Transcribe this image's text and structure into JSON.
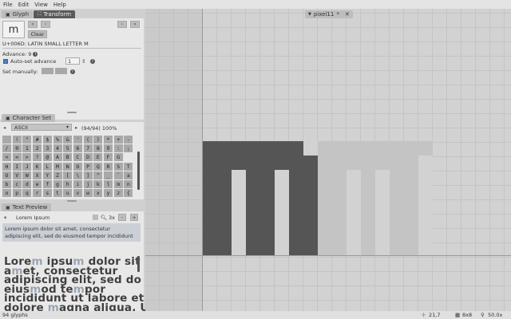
{
  "menu": [
    "File",
    "Edit",
    "View",
    "Help"
  ],
  "left_tabs": [
    {
      "icon": "▣",
      "label": "Glyph",
      "active": false
    },
    {
      "icon": "⛶",
      "label": "Transform",
      "active": true
    }
  ],
  "glyph": {
    "char": "m",
    "clear_label": "Clear",
    "nav_prev_prev": "«",
    "nav_prev": "‹",
    "nav_next": "›",
    "nav_next_next": "»",
    "code_label": "U+006D: LATIN SMALL LETTER M",
    "advance_label": "Advance: 9",
    "auto_advance_label": "Auto-set advance",
    "auto_advance_value": "1",
    "set_manually_label": "Set manually:"
  },
  "charset": {
    "tab_label": "Character Set",
    "tab_icon": "▣",
    "selected_set": "ASCII",
    "count_label": "(94/94) 100%",
    "rows": [
      [
        " ",
        "!",
        "\"",
        "#",
        "$",
        "%",
        "&",
        "'",
        "(",
        ")",
        "*",
        "+",
        "-"
      ],
      [
        "/",
        "0",
        "1",
        "2",
        "3",
        "4",
        "5",
        "6",
        "7",
        "8",
        "9",
        ":",
        ";"
      ],
      [
        "<",
        "=",
        ">",
        "?",
        "@",
        "A",
        "B",
        "C",
        "D",
        "E",
        "F",
        "G"
      ],
      [
        "H",
        "I",
        "J",
        "K",
        "L",
        "M",
        "N",
        "O",
        "P",
        "Q",
        "R",
        "S",
        "T"
      ],
      [
        "U",
        "V",
        "W",
        "X",
        "Y",
        "Z",
        "[",
        "\\",
        "]",
        "^",
        "_",
        "`",
        "a"
      ],
      [
        "b",
        "c",
        "d",
        "e",
        "f",
        "g",
        "h",
        "i",
        "j",
        "k",
        "l",
        "m",
        "n"
      ],
      [
        "o",
        "p",
        "q",
        "r",
        "s",
        "t",
        "u",
        "v",
        "w",
        "x",
        "y",
        "z",
        "{"
      ]
    ]
  },
  "preview": {
    "tab_label": "Text Preview",
    "tab_icon": "▣",
    "dropdown": "Lorem Ipsum",
    "scale": "3x",
    "input_text_line1": "Lorem ipsum dolor sit amet, consectetur",
    "input_text_line2": "adipiscing elit, sed do eiusmod tempor incididunt",
    "lines": [
      [
        {
          "t": "Lore",
          "h": false
        },
        {
          "t": "m",
          "h": true
        },
        {
          "t": " ipsu",
          "h": false
        },
        {
          "t": "m",
          "h": true
        },
        {
          "t": " dolor sit",
          "h": false
        }
      ],
      [
        {
          "t": "a",
          "h": false
        },
        {
          "t": "m",
          "h": true
        },
        {
          "t": "et, consectetur",
          "h": false
        }
      ],
      [
        {
          "t": "adipiscing elit, sed do",
          "h": false
        }
      ],
      [
        {
          "t": "eius",
          "h": false
        },
        {
          "t": "m",
          "h": true
        },
        {
          "t": "od te",
          "h": false
        },
        {
          "t": "m",
          "h": true
        },
        {
          "t": "por",
          "h": false
        }
      ],
      [
        {
          "t": "incididunt ut labore et",
          "h": false
        }
      ],
      [
        {
          "t": "dolore ",
          "h": false
        },
        {
          "t": "m",
          "h": true
        },
        {
          "t": "agna aliqua. Ut",
          "h": false
        }
      ]
    ]
  },
  "canvas": {
    "tab_label": "pixel11",
    "tab_modified": "*",
    "colors": {
      "ink": "#555555",
      "ghost": "#c4c4c4",
      "bg": "#d2d2d2",
      "margin": "#c8c8c8"
    }
  },
  "status": {
    "glyph_count": "94 glyphs",
    "cursor": "21,7",
    "cursor_icon": "crosshair-icon",
    "grid_size": "8x8",
    "zoom": "50.0x"
  }
}
